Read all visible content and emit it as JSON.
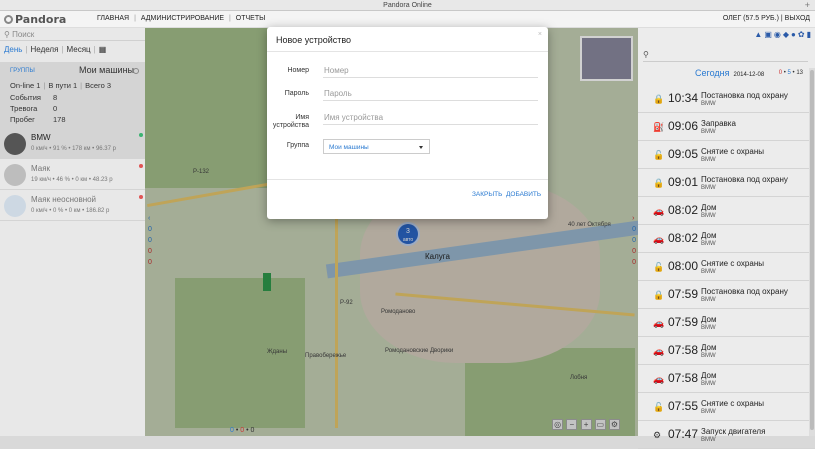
{
  "window": {
    "title": "Pandora Online",
    "plus": "+"
  },
  "logo": "Pandora",
  "nav": {
    "home": "ГЛАВНАЯ",
    "admin": "АДМИНИСТРИРОВАНИЕ",
    "reports": "ОТЧЕТЫ",
    "sep": "|"
  },
  "user": {
    "name": "ОЛЕГ (57.5 РУБ.)",
    "sep": "|",
    "logout": "ВЫХОД"
  },
  "sidebar": {
    "search_placeholder": "Поиск",
    "periods": [
      "День",
      "Неделя",
      "Месяц"
    ],
    "groups_label": "ГРУППЫ",
    "group_title": "Мои машины",
    "stats": {
      "online": "On-line 1",
      "moving": "В пути 1",
      "total": "Всего 3",
      "events_label": "События",
      "events_value": "8",
      "alarm_label": "Тревога",
      "alarm_value": "0",
      "mileage_label": "Пробег",
      "mileage_value": "178"
    },
    "devices": [
      {
        "name": "BMW",
        "meta": "0 км/ч • 91 % • 178 км • 96.37 р",
        "status": "#3cb371"
      },
      {
        "name": "Маяк",
        "meta": "19 км/ч • 46 % • 0 км • 48.23 р",
        "status": "#e05555"
      },
      {
        "name": "Маяк неосновной",
        "meta": "0 км/ч • 0 % • 0 км • 186.82 р",
        "status": "#e05555"
      }
    ]
  },
  "map": {
    "cluster_count": "3",
    "cluster_label": "авто",
    "labels": {
      "kaluga": "Калуга",
      "p132": "Р-132",
      "r92": "Р-92",
      "oct": "40 лет Октября",
      "romod": "Ромодановские Дворики",
      "romod2": "Ромоданово",
      "zhdan": "Жданы",
      "pravo": "Правобережье",
      "lubli": "Лобня"
    },
    "left_counts": [
      "0",
      "0",
      "0",
      "0"
    ],
    "right_counts": [
      "0",
      "0",
      "0",
      "0"
    ],
    "bottom": {
      "a": "0",
      "b": "0",
      "c": "0"
    },
    "zoom_minus": "−",
    "zoom_plus": "+"
  },
  "right": {
    "search_placeholder": "",
    "today": "Сегодня",
    "date": "2014-12-08",
    "counts": {
      "r": "0",
      "b": "5",
      "n": "13"
    },
    "events": [
      {
        "time": "10:34",
        "title": "Постановка под охрану",
        "car": "BMW",
        "icon": "lock"
      },
      {
        "time": "09:06",
        "title": "Заправка",
        "car": "BMW",
        "icon": "fuel"
      },
      {
        "time": "09:05",
        "title": "Снятие с охраны",
        "car": "BMW",
        "icon": "unlock"
      },
      {
        "time": "09:01",
        "title": "Постановка под охрану",
        "car": "BMW",
        "icon": "lock"
      },
      {
        "time": "08:02",
        "title": "Дом",
        "car": "BMW",
        "icon": "car"
      },
      {
        "time": "08:02",
        "title": "Дом",
        "car": "BMW",
        "icon": "car"
      },
      {
        "time": "08:00",
        "title": "Снятие с охраны",
        "car": "BMW",
        "icon": "unlock"
      },
      {
        "time": "07:59",
        "title": "Постановка под охрану",
        "car": "BMW",
        "icon": "lock"
      },
      {
        "time": "07:59",
        "title": "Дом",
        "car": "BMW",
        "icon": "car"
      },
      {
        "time": "07:58",
        "title": "Дом",
        "car": "BMW",
        "icon": "car"
      },
      {
        "time": "07:58",
        "title": "Дом",
        "car": "BMW",
        "icon": "car"
      },
      {
        "time": "07:55",
        "title": "Снятие с охраны",
        "car": "BMW",
        "icon": "unlock"
      },
      {
        "time": "07:47",
        "title": "Запуск двигателя",
        "car": "BMW",
        "icon": "engine"
      }
    ]
  },
  "modal": {
    "title": "Новое устройство",
    "close": "×",
    "fields": {
      "number_label": "Номер",
      "number_placeholder": "Номер",
      "password_label": "Пароль",
      "password_placeholder": "Пароль",
      "name_label": "Имя устройства",
      "name_placeholder": "Имя устройства",
      "group_label": "Группа",
      "group_value": "Мои машины"
    },
    "close_btn": "ЗАКРЫТЬ",
    "add_btn": "ДОБАВИТЬ"
  },
  "colors": {
    "accent": "#2a7ad1",
    "alert": "#c33"
  }
}
